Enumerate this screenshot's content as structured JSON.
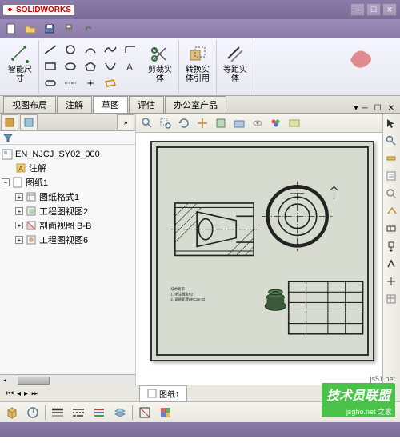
{
  "app": {
    "name": "SOLIDWORKS"
  },
  "ribbon": {
    "smart_dim": "智能尺\n寸",
    "trim": "剪裁实\n体",
    "convert": "转换实\n体引用",
    "offset": "等距实\n体"
  },
  "tabs": {
    "layout": "视图布局",
    "annotation": "注解",
    "sketch": "草图",
    "evaluate": "评估",
    "office": "办公室产品"
  },
  "tree": {
    "root": "EN_NJCJ_SY02_000",
    "annotations": "注解",
    "sheet": "图纸1",
    "items": [
      "图纸格式1",
      "工程图视图2",
      "剖面视图 B-B",
      "工程图视图6"
    ]
  },
  "sheet_tab": "图纸1",
  "watermark": {
    "main": "技术员联盟",
    "sub": "之家",
    "url": "jsgho.net",
    "url2": "js51.net"
  }
}
